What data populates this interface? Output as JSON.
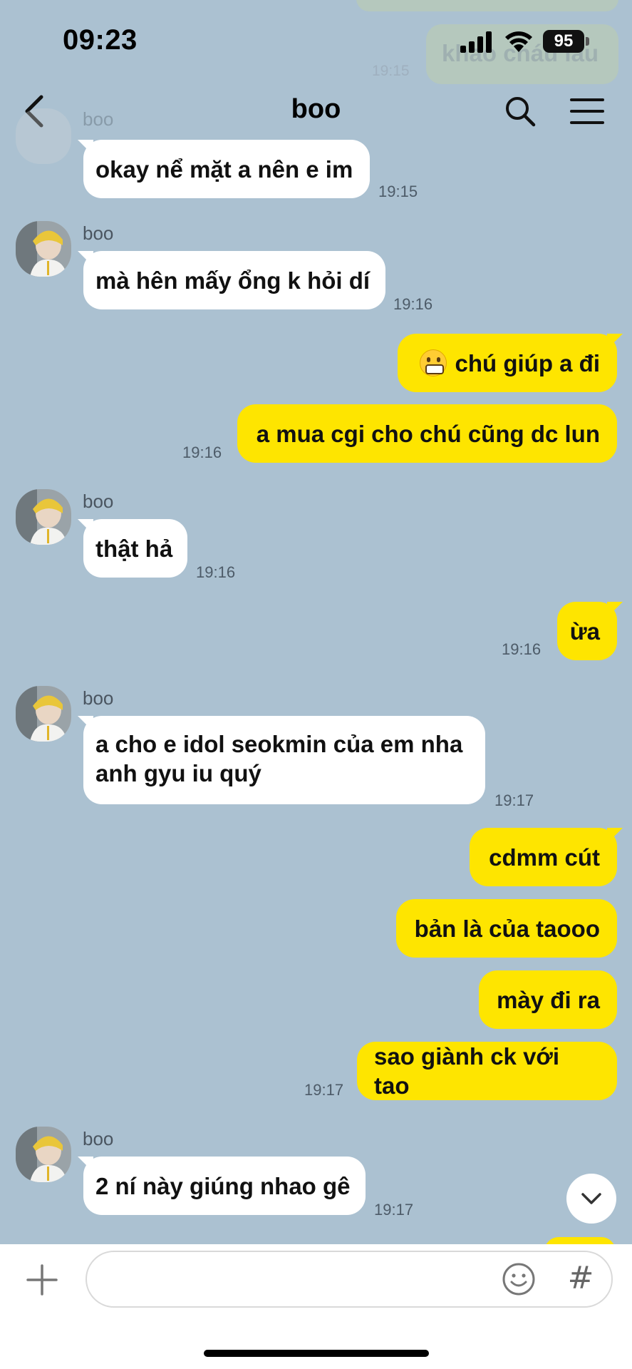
{
  "status_bar": {
    "time": "09:23",
    "battery": "95"
  },
  "header": {
    "title": "boo"
  },
  "background_remnant": {
    "text": "khao cháu lẩu",
    "time": "19:15"
  },
  "messages": [
    {
      "dir": "in",
      "sender": "boo",
      "text": "okay nể mặt a nên e im",
      "time": "19:15"
    },
    {
      "dir": "in",
      "sender": "boo",
      "text": "mà hên mấy ổng k hỏi dí",
      "time": "19:16"
    },
    {
      "dir": "out",
      "emoji": "grimacing-face-emoji",
      "text": "chú giúp a đi"
    },
    {
      "dir": "out",
      "text": "a mua cgi cho chú cũng dc lun",
      "time": "19:16"
    },
    {
      "dir": "in",
      "sender": "boo",
      "text": "thật hả",
      "time": "19:16"
    },
    {
      "dir": "out",
      "text": "ừa",
      "time": "19:16"
    },
    {
      "dir": "in",
      "sender": "boo",
      "text_line1": "a cho e idol seokmin của em nha",
      "text_line2": "anh gyu iu quý",
      "time": "19:17"
    },
    {
      "dir": "out",
      "text": "cdmm cút"
    },
    {
      "dir": "out",
      "text": "bản là của taooo"
    },
    {
      "dir": "out",
      "text": "mày đi ra"
    },
    {
      "dir": "out",
      "text": "sao giành ck với tao",
      "time": "19:17"
    },
    {
      "dir": "in",
      "sender": "boo",
      "text": "2 ní này giúng nhao gê",
      "time": "19:17"
    }
  ],
  "input": {
    "placeholder": ""
  },
  "icons": {
    "back": "chevron-left-icon",
    "search": "search-icon",
    "menu": "hamburger-menu-icon",
    "plus": "plus-icon",
    "emoji": "smiley-icon",
    "hash": "#"
  },
  "colors": {
    "background": "#abc1d1",
    "outgoing_bubble": "#fee500",
    "incoming_bubble": "#ffffff"
  }
}
